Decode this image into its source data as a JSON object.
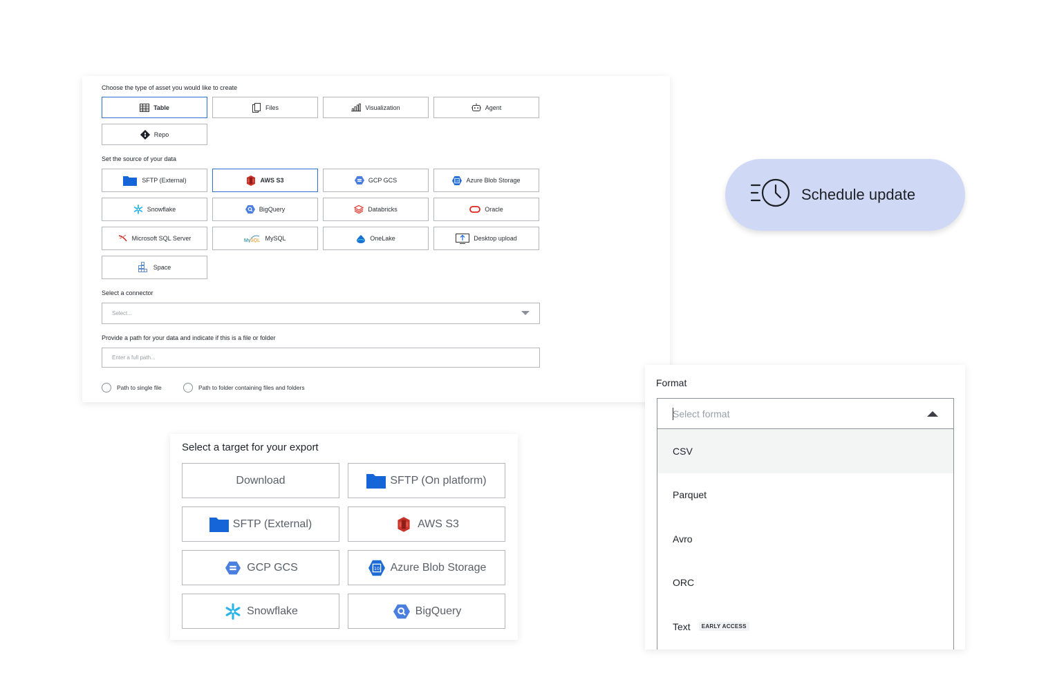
{
  "asset_section": {
    "label": "Choose the type of asset you would like to create",
    "options": [
      {
        "label": "Table",
        "icon": "table-icon",
        "selected": true
      },
      {
        "label": "Files",
        "icon": "files-icon",
        "selected": false
      },
      {
        "label": "Visualization",
        "icon": "bar-chart-icon",
        "selected": false
      },
      {
        "label": "Agent",
        "icon": "robot-icon",
        "selected": false
      },
      {
        "label": "Repo",
        "icon": "git-icon",
        "selected": false
      }
    ]
  },
  "source_section": {
    "label": "Set the source of your data",
    "options": [
      {
        "label": "SFTP (External)",
        "icon": "folder-icon",
        "selected": false
      },
      {
        "label": "AWS S3",
        "icon": "aws-s3-icon",
        "selected": true
      },
      {
        "label": "GCP GCS",
        "icon": "gcp-gcs-icon",
        "selected": false
      },
      {
        "label": "Azure Blob Storage",
        "icon": "azure-blob-icon",
        "selected": false
      },
      {
        "label": "Snowflake",
        "icon": "snowflake-icon",
        "selected": false
      },
      {
        "label": "BigQuery",
        "icon": "bigquery-icon",
        "selected": false
      },
      {
        "label": "Databricks",
        "icon": "databricks-icon",
        "selected": false
      },
      {
        "label": "Oracle",
        "icon": "oracle-icon",
        "selected": false
      },
      {
        "label": "Microsoft SQL Server",
        "icon": "sql-server-icon",
        "selected": false
      },
      {
        "label": "MySQL",
        "icon": "mysql-icon",
        "selected": false
      },
      {
        "label": "OneLake",
        "icon": "onelake-icon",
        "selected": false
      },
      {
        "label": "Desktop upload",
        "icon": "upload-icon",
        "selected": false
      },
      {
        "label": "Space",
        "icon": "space-icon",
        "selected": false
      }
    ]
  },
  "connector": {
    "label": "Select a connector",
    "placeholder": "Select..."
  },
  "path": {
    "label": "Provide a path for your data and indicate if this is a file or folder",
    "placeholder": "Enter a full path...",
    "radio_file": "Path to single file",
    "radio_folder": "Path to folder containing files and folders"
  },
  "schedule": {
    "label": "Schedule update",
    "icon": "schedule-clock-icon"
  },
  "export": {
    "title": "Select a target for your export",
    "options": [
      {
        "label": "Download",
        "icon": ""
      },
      {
        "label": "SFTP (On platform)",
        "icon": "folder-icon"
      },
      {
        "label": "SFTP (External)",
        "icon": "folder-icon"
      },
      {
        "label": "AWS S3",
        "icon": "aws-s3-icon"
      },
      {
        "label": "GCP GCS",
        "icon": "gcp-gcs-icon"
      },
      {
        "label": "Azure Blob Storage",
        "icon": "azure-blob-icon"
      },
      {
        "label": "Snowflake",
        "icon": "snowflake-icon"
      },
      {
        "label": "BigQuery",
        "icon": "bigquery-icon"
      }
    ]
  },
  "format": {
    "label": "Format",
    "placeholder": "Select format",
    "options": [
      {
        "label": "CSV",
        "badge": ""
      },
      {
        "label": "Parquet",
        "badge": ""
      },
      {
        "label": "Avro",
        "badge": ""
      },
      {
        "label": "ORC",
        "badge": ""
      },
      {
        "label": "Text",
        "badge": "EARLY ACCESS"
      }
    ]
  },
  "colors": {
    "selected_border": "#2f6fd6",
    "schedule_bg": "#cfd9f5",
    "border": "#b4b8bd",
    "folder_blue": "#1565d8",
    "aws_red": "#c7332b",
    "gcp_blue": "#4a7fe0",
    "snowflake_cyan": "#29b5e8",
    "oracle_red": "#e2231a"
  }
}
